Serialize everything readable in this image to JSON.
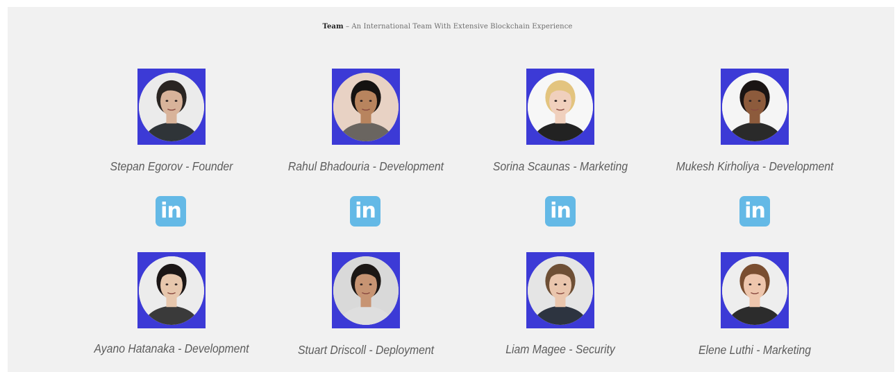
{
  "heading": {
    "strong": "Team",
    "rest": " – An International Team With Extensive Blockchain Experience"
  },
  "members": [
    {
      "name": "Stepan Egorov - Founder",
      "skin": "#d8b39a",
      "hair": "#2a2522",
      "shirt": "#2f3438",
      "bg": "#ebebeb"
    },
    {
      "name": "Rahul Bhadouria - Development",
      "skin": "#b8845e",
      "hair": "#151211",
      "shirt": "#6a6560",
      "bg": "#e8d2c4"
    },
    {
      "name": "Sorina Scaunas - Marketing",
      "skin": "#f0d0bd",
      "hair": "#e3c47f",
      "shirt": "#222222",
      "bg": "#f7f7f7"
    },
    {
      "name": "Mukesh Kirholiya - Development",
      "skin": "#8d5b3c",
      "hair": "#1a1413",
      "shirt": "#2a2a2a",
      "bg": "#f5f5f5"
    },
    {
      "name": "Ayano Hatanaka - Development",
      "skin": "#e7c7ad",
      "hair": "#1b1616",
      "shirt": "#3a3a3a",
      "bg": "#ececec"
    },
    {
      "name": "Stuart Driscoll - Deployment",
      "skin": "#c79473",
      "hair": "#1c1715",
      "shirt": "#dedede",
      "bg": "#d9d9d9"
    },
    {
      "name": "Liam Magee - Security",
      "skin": "#eac6ad",
      "hair": "#6e4f35",
      "shirt": "#2d3440",
      "bg": "#e5e5e5"
    },
    {
      "name": "Elene Luthi - Marketing",
      "skin": "#eec6ad",
      "hair": "#7a4e30",
      "shirt": "#2c2c2c",
      "bg": "#eeeeee"
    }
  ],
  "linkedin": {
    "label": "in",
    "color": "#64b9e6"
  },
  "colors": {
    "photo_frame": "#3c3ad6",
    "panel_bg": "#f1f1f1"
  }
}
